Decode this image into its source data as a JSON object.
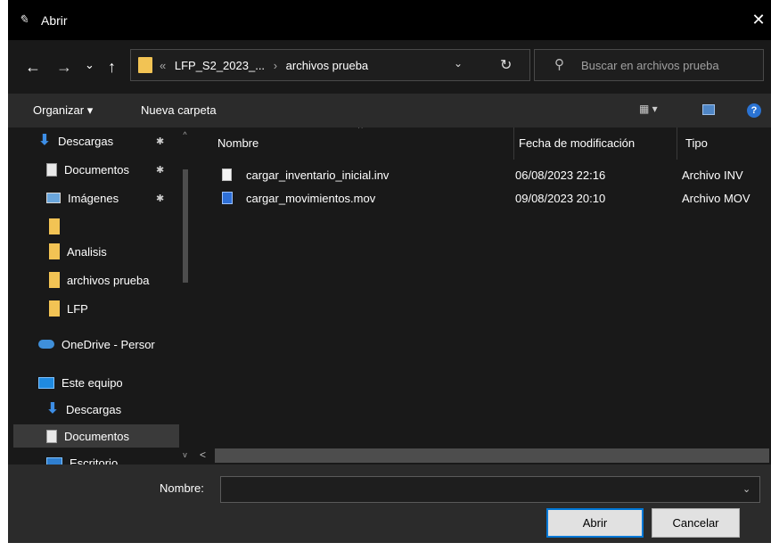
{
  "window": {
    "title": "Abrir",
    "app_icon": "feather-icon",
    "close_label": "✕"
  },
  "navigation": {
    "back": "←",
    "forward": "→",
    "recent": "⌄",
    "up": "↑",
    "address": {
      "overflow": "«",
      "crumbs": [
        "LFP_S2_2023_...",
        "archivos prueba"
      ],
      "separator": "›"
    },
    "refresh": "↻",
    "search": {
      "placeholder": "Buscar en archivos prueba"
    }
  },
  "toolbar": {
    "organize_label": "Organizar ▾",
    "new_folder_label": "Nueva carpeta",
    "view_label": "▦ ▾",
    "help_label": "?"
  },
  "nav_pane": {
    "items": [
      {
        "label": "Descargas",
        "icon": "download-icon",
        "pinned": true
      },
      {
        "label": "Documentos",
        "icon": "document-icon",
        "pinned": true
      },
      {
        "label": "Imágenes",
        "icon": "pictures-icon",
        "pinned": true
      },
      {
        "label": "",
        "icon": "folder-icon",
        "pinned": false
      },
      {
        "label": "Analisis",
        "icon": "folder-icon",
        "pinned": false
      },
      {
        "label": "archivos prueba",
        "icon": "folder-icon",
        "pinned": false
      },
      {
        "label": "LFP",
        "icon": "folder-icon",
        "pinned": false
      },
      {
        "label": "OneDrive - Persor",
        "icon": "onedrive-icon",
        "pinned": false
      },
      {
        "label": "Este equipo",
        "icon": "computer-icon",
        "pinned": false
      },
      {
        "label": "Descargas",
        "icon": "download-icon",
        "pinned": false
      },
      {
        "label": "Documentos",
        "icon": "document-icon",
        "pinned": false,
        "selected": true
      },
      {
        "label": "Escritorio",
        "icon": "desktop-icon",
        "pinned": false
      }
    ],
    "pin_glyph": "✱"
  },
  "file_list": {
    "columns": {
      "name": "Nombre",
      "modified": "Fecha de modificación",
      "type": "Tipo"
    },
    "rows": [
      {
        "name": "cargar_inventario_inicial.inv",
        "modified": "06/08/2023 22:16",
        "type": "Archivo INV",
        "icon": "file-icon"
      },
      {
        "name": "cargar_movimientos.mov",
        "modified": "09/08/2023 20:10",
        "type": "Archivo MOV",
        "icon": "media-file-icon"
      }
    ]
  },
  "footer": {
    "filename_label": "Nombre:",
    "filename_value": "",
    "open_label": "Abrir",
    "cancel_label": "Cancelar"
  },
  "colors": {
    "background": "#191919",
    "titlebar": "#000000",
    "toolbar": "#2b2b2b",
    "folder": "#f2c354",
    "accent": "#0078d7"
  }
}
